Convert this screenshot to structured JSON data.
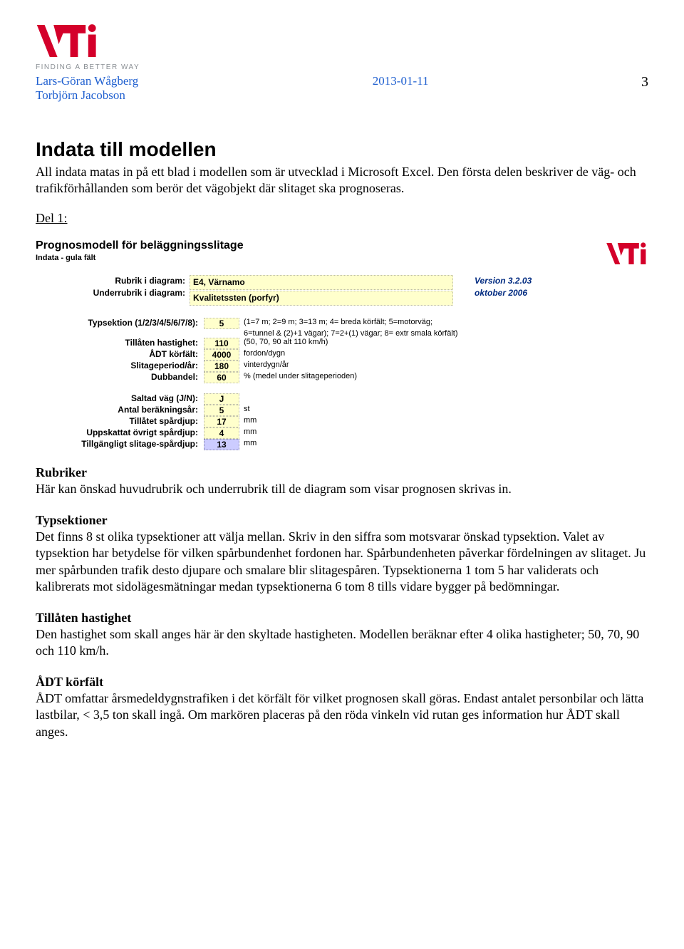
{
  "header": {
    "tagline": "FINDING A BETTER WAY",
    "author1": "Lars-Göran Wågberg",
    "author2": "Torbjörn Jacobson",
    "date": "2013-01-11",
    "page": "3"
  },
  "h1": "Indata till modellen",
  "intro": "All indata matas in på ett blad i modellen som är utvecklad i Microsoft Excel. Den första delen beskriver de väg- och trafikförhållanden som berör det vägobjekt där slitaget ska prognoseras.",
  "del1": "Del 1:",
  "model": {
    "title": "Prognosmodell för beläggningsslitage",
    "sub": "Indata - gula fält",
    "rubrik_label": "Rubrik i diagram:",
    "underrubrik_label": "Underrubrik i diagram:",
    "rubrik_value": "E4, Värnamo",
    "underrubrik_value": "Kvalitetssten (porfyr)",
    "version": "Version 3.2.03",
    "version_date": "oktober 2006"
  },
  "params": [
    {
      "label": "Typsektion (1/2/3/4/5/6/7/8):",
      "value": "5",
      "desc": "(1=7 m; 2=9 m; 3=13 m; 4= breda körfält; 5=motorväg;"
    },
    {
      "label": "",
      "value": "",
      "desc": "6=tunnel & (2)+1 vägar);  7=2+(1) vägar; 8= extr smala körfält)"
    },
    {
      "label": "Tillåten hastighet:",
      "value": "110",
      "desc": "(50, 70, 90 alt 110 km/h)"
    },
    {
      "label": "ÅDT körfält:",
      "value": "4000",
      "desc": "fordon/dygn"
    },
    {
      "label": "Slitageperiod/år:",
      "value": "180",
      "desc": "vinterdygn/år"
    },
    {
      "label": "Dubbandel:",
      "value": "60",
      "desc": "% (medel under slitageperioden)"
    }
  ],
  "params2": [
    {
      "label": "Saltad väg (J/N):",
      "value": "J",
      "desc": "",
      "purple": false
    },
    {
      "label": "Antal beräkningsår:",
      "value": "5",
      "desc": "st",
      "purple": false
    },
    {
      "label": "Tillåtet spårdjup:",
      "value": "17",
      "desc": "mm",
      "purple": false
    },
    {
      "label": "Uppskattat övrigt spårdjup:",
      "value": "4",
      "desc": "mm",
      "purple": false
    },
    {
      "label": "Tillgängligt slitage-spårdjup:",
      "value": "13",
      "desc": "mm",
      "purple": true
    }
  ],
  "body": {
    "rubriker_h": "Rubriker",
    "rubriker_p": "Här kan önskad huvudrubrik och underrubrik till de diagram som visar prognosen skrivas in.",
    "typsek_h": "Typsektioner",
    "typsek_p": "Det finns 8 st olika typsektioner att välja mellan. Skriv in den siffra som motsvarar önskad typsektion. Valet av typsektion har betydelse för vilken spårbundenhet fordonen har. Spårbundenheten påverkar fördelningen av slitaget. Ju mer spårbunden trafik desto djupare och smalare blir slitagespåren. Typsektionerna 1 tom 5 har validerats och kalibrerats mot sidolägesmätningar medan typsektionerna 6 tom 8 tills vidare bygger på bedömningar.",
    "hast_h": "Tillåten hastighet",
    "hast_p": "Den hastighet som skall anges här är den skyltade hastigheten. Modellen beräknar efter 4 olika hastigheter; 50, 70, 90 och 110 km/h.",
    "adt_h": "ÅDT körfält",
    "adt_p": "ÅDT omfattar årsmedeldygnstrafiken i det körfält för vilket prognosen skall göras. Endast antalet personbilar och lätta lastbilar, < 3,5 ton skall ingå. Om markören placeras på den röda vinkeln vid rutan ges information hur ÅDT skall anges."
  }
}
